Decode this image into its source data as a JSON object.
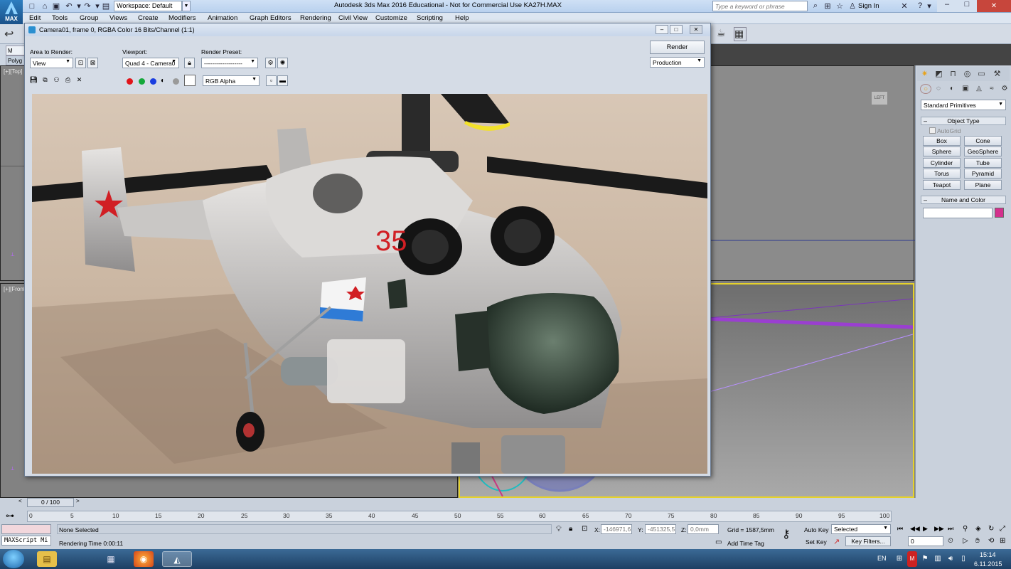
{
  "titlebar": {
    "logo_text": "MAX",
    "workspace_label": "Workspace: Default",
    "app_title": "Autodesk 3ds Max 2016 Educational - Not for Commercial Use    KA27H.MAX",
    "search_placeholder": "Type a keyword or phrase",
    "sign_in": "Sign In",
    "help": "?"
  },
  "menu": [
    "Edit",
    "Tools",
    "Group",
    "Views",
    "Create",
    "Modifiers",
    "Animation",
    "Graph Editors",
    "Rendering",
    "Civil View",
    "Customize",
    "Scripting",
    "Help"
  ],
  "ribbon": {
    "tab1": "M",
    "tab2": "Polyg"
  },
  "viewports": {
    "top_left": "[+][Top]",
    "bottom_left": "[+][Front]",
    "top_right_cube": "LEFT"
  },
  "render_window": {
    "title": "Camera01, frame 0, RGBA Color 16 Bits/Channel (1:1)",
    "area_label": "Area to Render:",
    "area_value": "View",
    "viewport_label": "Viewport:",
    "viewport_value": "Quad 4 - Camera0",
    "preset_label": "Render Preset:",
    "preset_value": "-------------------",
    "render_button": "Render",
    "production_value": "Production",
    "channel_value": "RGB Alpha",
    "helicopter_number": "35"
  },
  "command_panel": {
    "category": "Standard Primitives",
    "object_type_header": "Object Type",
    "autogrid": "AutoGrid",
    "primitives": [
      "Box",
      "Cone",
      "Sphere",
      "GeoSphere",
      "Cylinder",
      "Tube",
      "Torus",
      "Pyramid",
      "Teapot",
      "Plane"
    ],
    "name_color_header": "Name and Color",
    "object_color": "#d4308d"
  },
  "timeline": {
    "frame_counter": "0 / 100",
    "ticks": [
      "0",
      "5",
      "10",
      "15",
      "20",
      "25",
      "30",
      "35",
      "40",
      "45",
      "50",
      "55",
      "60",
      "65",
      "70",
      "75",
      "80",
      "85",
      "90",
      "95",
      "100"
    ]
  },
  "status": {
    "maxscript": "MAXScript Mi",
    "selection": "None Selected",
    "render_time": "Rendering Time  0:00:11",
    "x_label": "X:",
    "x_value": "-146971,6",
    "y_label": "Y:",
    "y_value": "-451325,5",
    "z_label": "Z:",
    "z_value": "0,0mm",
    "grid": "Grid = 1587,5mm",
    "add_time_tag": "Add Time Tag",
    "auto_key": "Auto Key",
    "set_key": "Set Key",
    "selected_value": "Selected",
    "key_filters": "Key Filters...",
    "frame_value": "0"
  },
  "taskbar": {
    "lang": "EN",
    "time": "15:14",
    "date": "6.11.2015"
  }
}
